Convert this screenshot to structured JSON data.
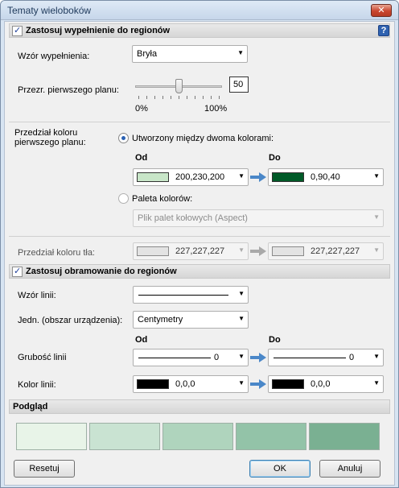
{
  "window": {
    "title": "Tematy wieloboków",
    "close_glyph": "✕"
  },
  "fill_section": {
    "checked": true,
    "title": "Zastosuj wypełnienie do regionów",
    "help_glyph": "?"
  },
  "fill_pattern": {
    "label": "Wzór wypełnienia:",
    "value": "Bryła"
  },
  "foreground_transparency": {
    "label": "Przezr. pierwszego planu:",
    "value": "50",
    "level_percent": 50,
    "min_label": "0%",
    "max_label": "100%"
  },
  "foreground_range": {
    "label_line1": "Przedział koloru",
    "label_line2": "pierwszego planu:",
    "option_two_colors": {
      "label": "Utworzony między dwoma kolorami:",
      "selected": true
    },
    "from_label": "Od",
    "to_label": "Do",
    "from_color": {
      "text": "200,230,200",
      "hex": "#c8e6c8"
    },
    "to_color": {
      "text": "0,90,40",
      "hex": "#005a28"
    },
    "option_palette": {
      "label": "Paleta kolorów:",
      "selected": false
    },
    "palette_value": "Plik palet kołowych (Aspect)"
  },
  "background_range": {
    "label": "Przedział koloru tła:",
    "from_color": {
      "text": "227,227,227",
      "hex": "#e3e3e3"
    },
    "to_color": {
      "text": "227,227,227",
      "hex": "#e3e3e3"
    }
  },
  "border_section": {
    "checked": true,
    "title": "Zastosuj obramowanie do regionów"
  },
  "line_pattern": {
    "label": "Wzór linii:"
  },
  "units": {
    "label": "Jedn. (obszar urządzenia):",
    "value": "Centymetry"
  },
  "border_range": {
    "from_label": "Od",
    "to_label": "Do",
    "thickness_label": "Grubość linii",
    "thickness_from": "0",
    "thickness_to": "0",
    "color_label": "Kolor linii:",
    "color_from": {
      "text": "0,0,0",
      "hex": "#000000"
    },
    "color_to": {
      "text": "0,0,0",
      "hex": "#000000"
    }
  },
  "preview": {
    "title": "Podgląd",
    "swatches": [
      "#e8f4e8",
      "#c9e3d2",
      "#afd4bd",
      "#93c3a8",
      "#7ab092"
    ]
  },
  "buttons": {
    "reset": "Resetuj",
    "ok": "OK",
    "cancel": "Anuluj"
  },
  "colors": {
    "arrow": "#4a87c8"
  }
}
